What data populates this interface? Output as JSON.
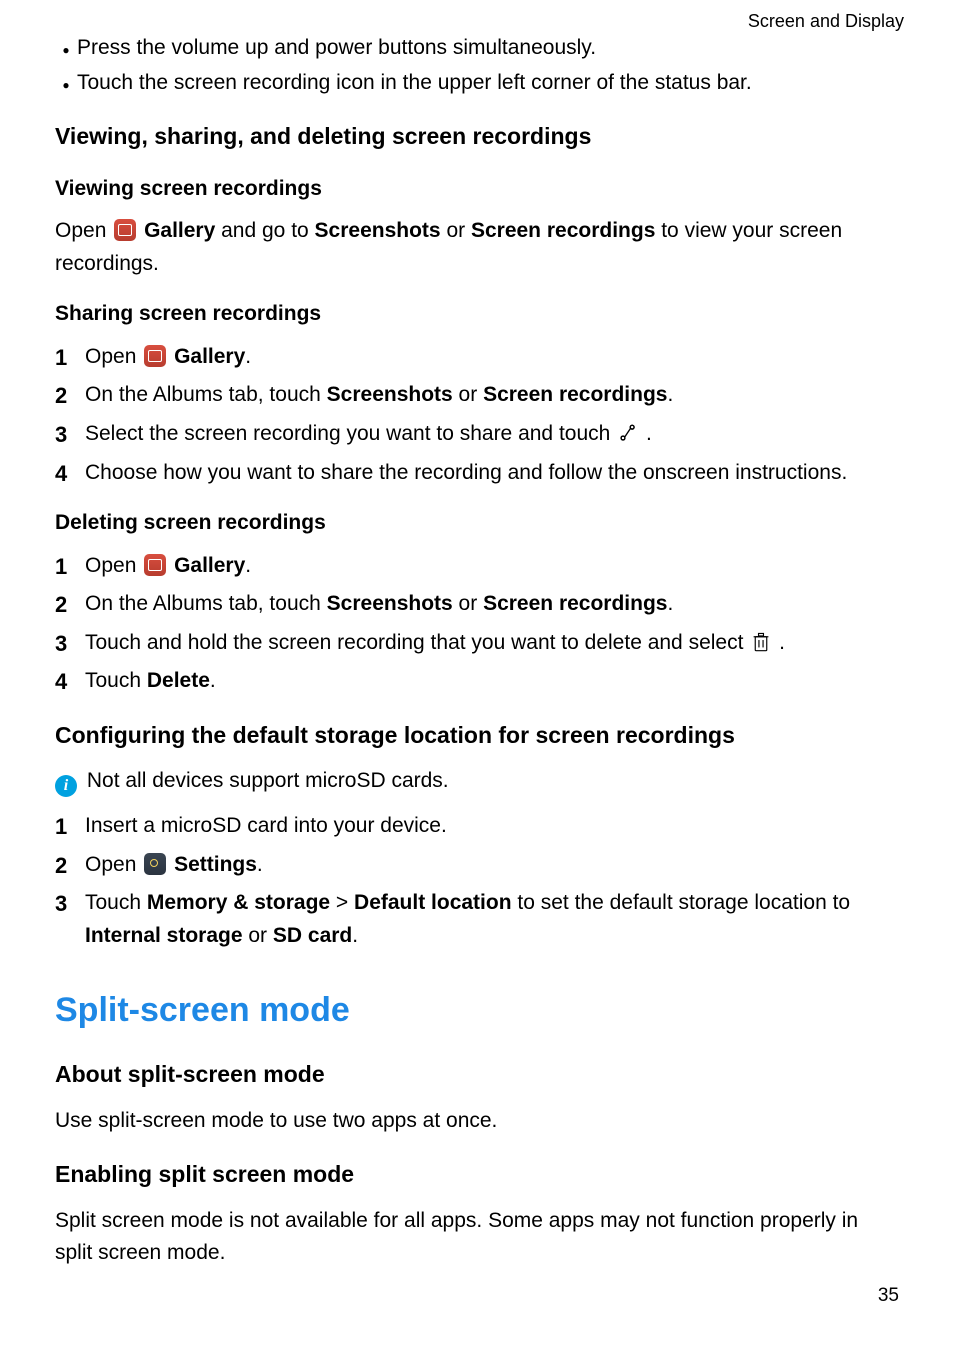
{
  "header": {
    "section_label": "Screen and Display"
  },
  "intro_bullets": [
    "Press the volume up and power buttons simultaneously.",
    "Touch the screen recording icon in the upper left corner of the status bar."
  ],
  "h2_viewing": "Viewing, sharing, and deleting screen recordings",
  "viewing": {
    "heading": "Viewing screen recordings",
    "open_prefix": "Open ",
    "gallery_label": "Gallery",
    "after_gallery": " and go to ",
    "screenshots_label": "Screenshots",
    "or": " or ",
    "screen_recordings_label": "Screen recordings",
    "tail": " to view your screen recordings."
  },
  "sharing": {
    "heading": "Sharing screen recordings",
    "step1_open": "Open ",
    "gallery_label": "Gallery",
    "step1_end": ".",
    "step2_a": "On the Albums tab, touch ",
    "step2_b": "Screenshots",
    "step2_or": " or ",
    "step2_c": "Screen recordings",
    "step2_end": ".",
    "step3": "Select the screen recording you want to share and touch ",
    "step3_end": ".",
    "step4": "Choose how you want to share the recording and follow the onscreen instructions."
  },
  "deleting": {
    "heading": "Deleting screen recordings",
    "step1_open": "Open ",
    "gallery_label": "Gallery",
    "step1_end": ".",
    "step2_a": "On the Albums tab, touch ",
    "step2_b": "Screenshots",
    "step2_or": " or ",
    "step2_c": "Screen recordings",
    "step2_end": ".",
    "step3": "Touch and hold the screen recording that you want to delete and select ",
    "step3_end": ".",
    "step4_a": "Touch ",
    "step4_b": "Delete",
    "step4_end": "."
  },
  "config": {
    "heading": "Configuring the default storage location for screen recordings",
    "note": "Not all devices support microSD cards.",
    "step1": "Insert a microSD card into your device.",
    "step2_open": "Open ",
    "settings_label": "Settings",
    "step2_end": ".",
    "step3_a": "Touch ",
    "step3_b": "Memory & storage",
    "step3_gt": " > ",
    "step3_c": "Default location",
    "step3_d": " to set the default storage location to ",
    "step3_e": "Internal storage",
    "step3_or": " or ",
    "step3_f": "SD card",
    "step3_end": "."
  },
  "split": {
    "title": "Split-screen mode",
    "about_heading": "About split-screen mode",
    "about_body": "Use split-screen mode to use two apps at once.",
    "enable_heading": "Enabling split screen mode",
    "enable_body": "Split screen mode is not available for all apps. Some apps may not function properly in split screen mode."
  },
  "page_number": "35"
}
